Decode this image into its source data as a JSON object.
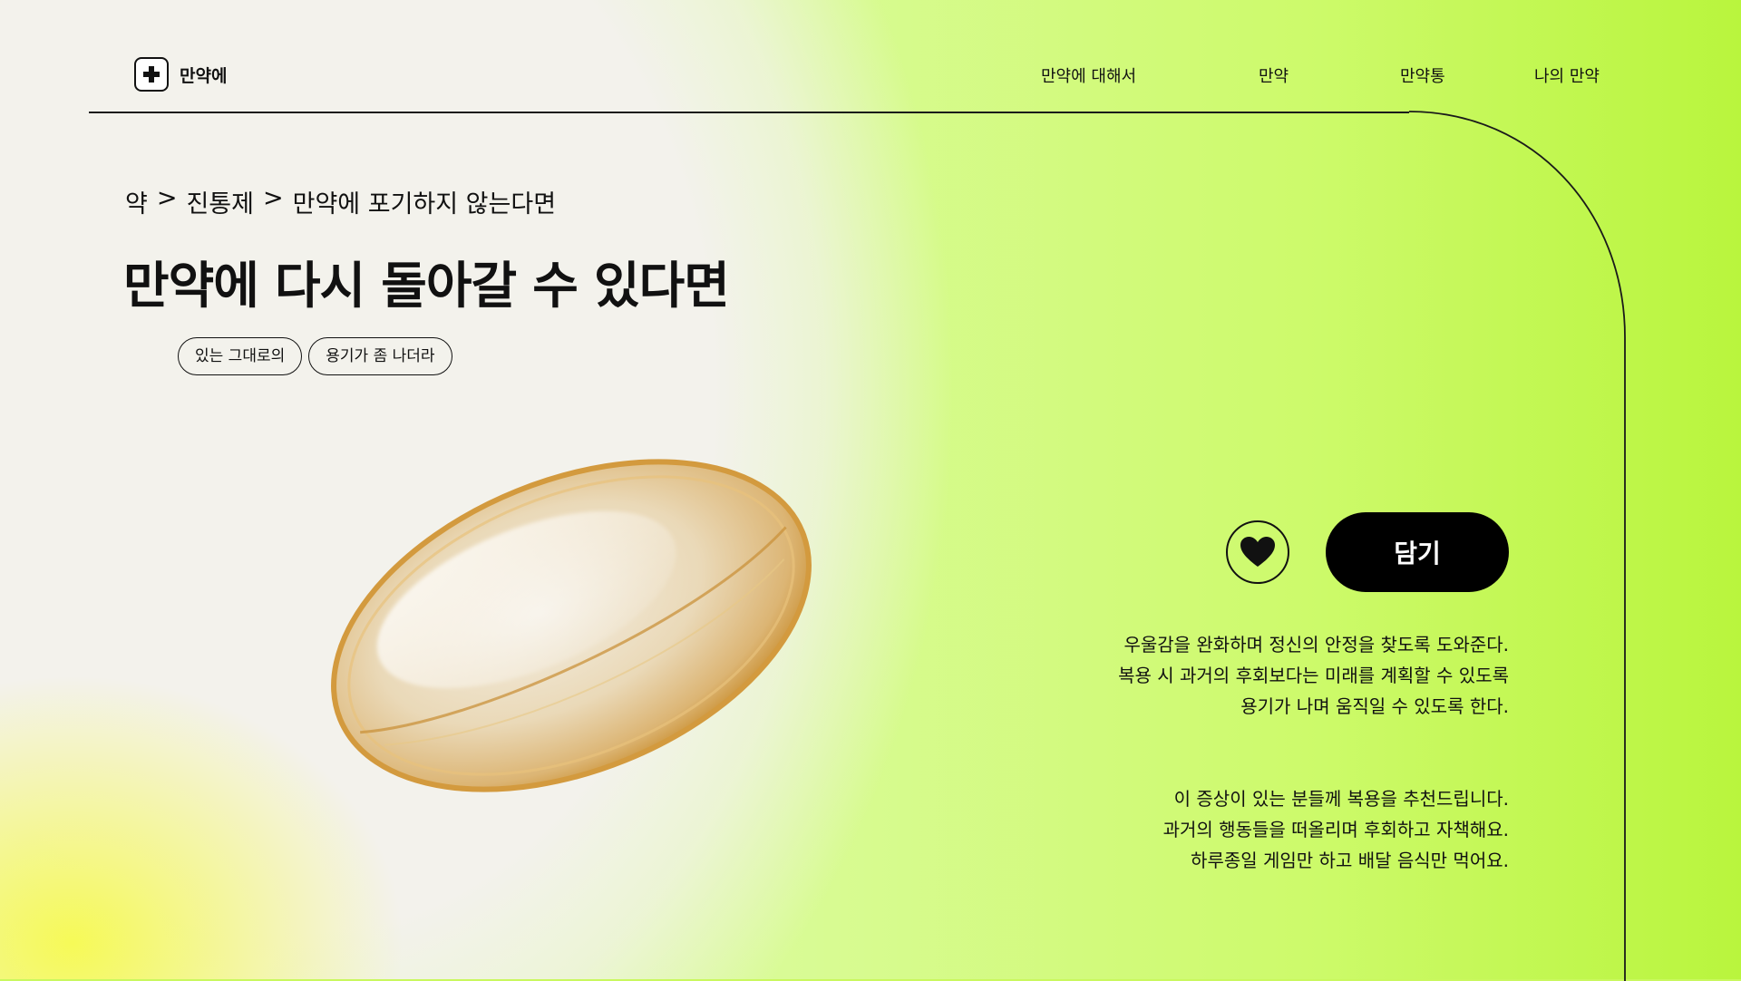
{
  "header": {
    "brand": "만약에",
    "nav": [
      "만약에 대해서",
      "만약",
      "만약통",
      "나의 만약"
    ]
  },
  "breadcrumb": [
    "약",
    "진통제",
    "만약에 포기하지 않는다면"
  ],
  "breadcrumb_separator": ">",
  "product": {
    "title": "만약에 다시 돌아갈 수 있다면",
    "tags": [
      "있는 그대로의",
      "용기가 좀 나더라"
    ],
    "add_label": "담기",
    "description": [
      "우울감을 완화하며 정신의 안정을 찾도록 도와준다.",
      "복용 시 과거의 후회보다는 미래를 계획할 수 있도록",
      "용기가 나며 움직일 수 있도록 한다."
    ],
    "recommendation": [
      "이 증상이 있는 분들께 복용을 추천드립니다.",
      "과거의 행동들을 떠올리며 후회하고 자책해요.",
      "하루종일 게임만 하고 배달 음식만 먹어요."
    ]
  },
  "icons": {
    "logo": "medical-cross-icon",
    "favorite": "heart-icon",
    "product_image": "softgel-capsule"
  },
  "colors": {
    "accent": "#c9f85e",
    "primary_button": "#000000"
  }
}
